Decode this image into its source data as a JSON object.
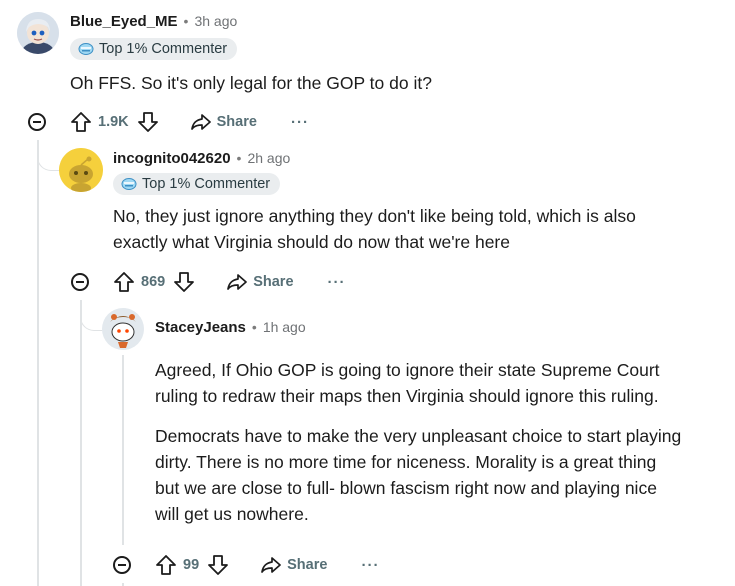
{
  "comments": [
    {
      "username": "Blue_Eyed_ME",
      "separator": "•",
      "time": "3h ago",
      "flair": "Top 1% Commenter",
      "body": "Oh FFS. So it's only legal for the GOP to do it?",
      "score": "1.9K",
      "share_label": "Share",
      "more_label": "···"
    },
    {
      "username": "incognito042620",
      "separator": "•",
      "time": "2h ago",
      "flair": "Top 1% Commenter",
      "body_lines": [
        "No, they just ignore anything they don't like being told, which is also",
        "exactly what Virginia should do now that we're here"
      ],
      "score": "869",
      "share_label": "Share",
      "more_label": "···"
    },
    {
      "username": "StaceyJeans",
      "separator": "•",
      "time": "1h ago",
      "paragraph1_lines": [
        "Agreed, If Ohio GOP is going to ignore their state Supreme Court",
        "ruling to redraw their maps then Virginia should ignore this ruling."
      ],
      "paragraph2_lines": [
        "Democrats have to make the very unpleasant choice to start playing",
        "dirty. There is no more time for niceness. Morality is a great thing",
        "but we are close to full- blown fascism right now and playing nice",
        "will get us nowhere."
      ],
      "score": "99",
      "share_label": "Share",
      "more_label": "···"
    }
  ]
}
